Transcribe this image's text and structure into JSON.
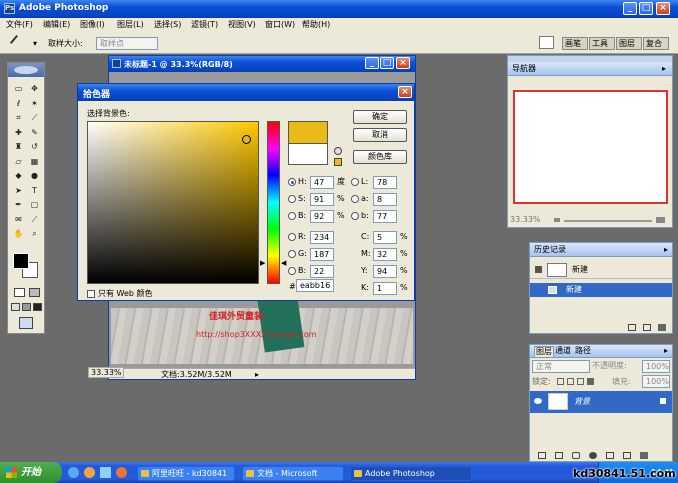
{
  "app": {
    "title": "Adobe Photoshop"
  },
  "menu": [
    "文件(F)",
    "编辑(E)",
    "图像(I)",
    "图层(L)",
    "选择(S)",
    "滤镜(T)",
    "视图(V)",
    "窗口(W)",
    "帮助(H)"
  ],
  "options_bar": {
    "sample_label": "取样大小:",
    "sample_value": "取样点"
  },
  "palette_well_tabs": [
    "画笔",
    "工具",
    "图层",
    "复合"
  ],
  "document": {
    "title": "未标题-1 @ 33.3%(RGB/8)",
    "zoom": "33.33%",
    "doc_size": "文档:3.52M/3.52M",
    "watermark_title": "佳琪外贸童装",
    "watermark_url": "http://shop3XXXX.taobao.com"
  },
  "color_picker": {
    "title": "拾色器",
    "subtitle": "选择背景色:",
    "ok": "确定",
    "cancel": "取消",
    "color_library": "颜色库",
    "web_only": "只有 Web 颜色",
    "new_color": "#eabb16",
    "current_color": "#ffffff",
    "hsb": [
      {
        "label": "H:",
        "value": "47",
        "unit": "度",
        "selected": true
      },
      {
        "label": "S:",
        "value": "91",
        "unit": "%",
        "selected": false
      },
      {
        "label": "B:",
        "value": "92",
        "unit": "%",
        "selected": false
      }
    ],
    "rgb": [
      {
        "label": "R:",
        "value": "234"
      },
      {
        "label": "G:",
        "value": "187"
      },
      {
        "label": "B:",
        "value": "22"
      }
    ],
    "lab": [
      {
        "label": "L:",
        "value": "78"
      },
      {
        "label": "a:",
        "value": "8"
      },
      {
        "label": "b:",
        "value": "77"
      }
    ],
    "cmyk": [
      {
        "label": "C:",
        "value": "5",
        "unit": "%"
      },
      {
        "label": "M:",
        "value": "32",
        "unit": "%"
      },
      {
        "label": "Y:",
        "value": "94",
        "unit": "%"
      },
      {
        "label": "K:",
        "value": "1",
        "unit": "%"
      }
    ],
    "hex_label": "#",
    "hex_value": "eabb16",
    "hue_level": 0.13
  },
  "navigator": {
    "title": "导航器",
    "zoom": "33.33%"
  },
  "history": {
    "title": "历史记录",
    "snapshot": "新建",
    "step": "新建"
  },
  "layers": {
    "tabs": [
      "图层",
      "通道",
      "路径"
    ],
    "blend_mode": "正常",
    "opacity_label": "不透明度:",
    "opacity_value": "100%",
    "lock_label": "锁定:",
    "fill_label": "填充:",
    "fill_value": "100%",
    "layer_name": "背景"
  },
  "taskbar": {
    "start": "开始",
    "tasks": [
      "阿里旺旺 - kd30841",
      "文档 - Microsoft",
      "Adobe Photoshop"
    ],
    "clock": "14:41"
  },
  "site_watermark": "kd30841.51.com"
}
